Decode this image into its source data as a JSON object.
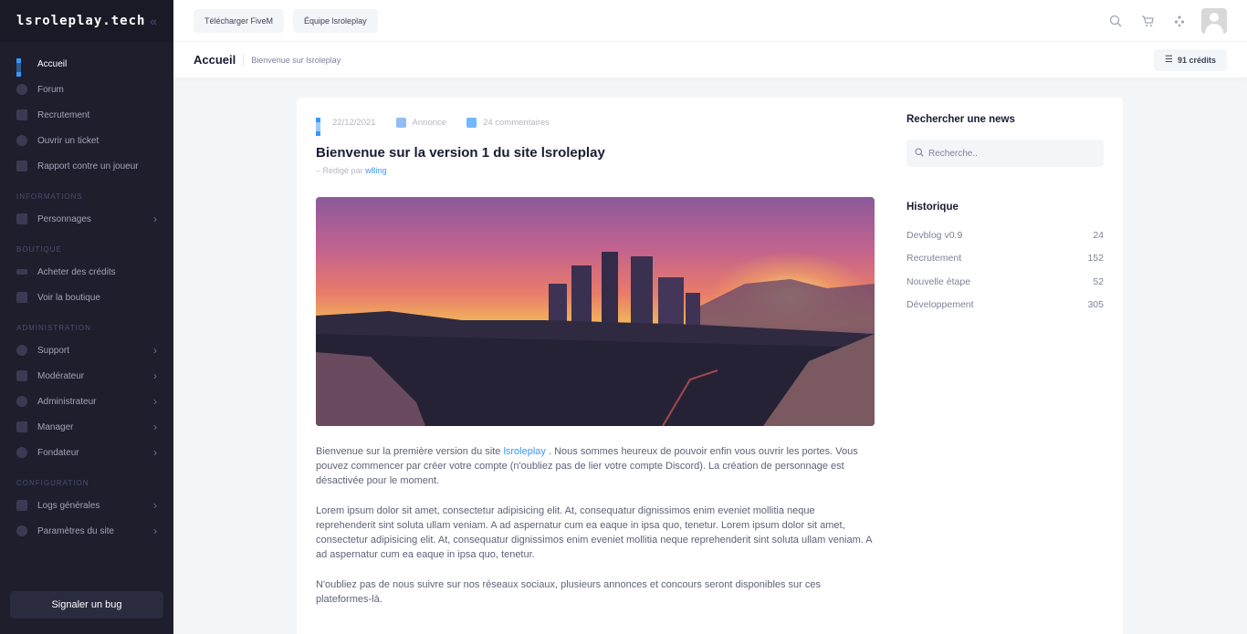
{
  "sidebar": {
    "brand": "lsroleplay.tech",
    "main_items": [
      {
        "label": "Accueil"
      },
      {
        "label": "Forum"
      },
      {
        "label": "Recrutement"
      },
      {
        "label": "Ouvrir un ticket"
      },
      {
        "label": "Rapport contre un joueur"
      }
    ],
    "sections": {
      "informations": "INFORMATIONS",
      "boutique": "BOUTIQUE",
      "administration": "ADMINISTRATION",
      "configuration": "CONFIGURATION"
    },
    "info_items": [
      {
        "label": "Personnages"
      }
    ],
    "shop_items": [
      {
        "label": "Acheter des crédits"
      },
      {
        "label": "Voir la boutique"
      }
    ],
    "admin_items": [
      {
        "label": "Support"
      },
      {
        "label": "Modérateur"
      },
      {
        "label": "Administrateur"
      },
      {
        "label": "Manager"
      },
      {
        "label": "Fondateur"
      }
    ],
    "config_items": [
      {
        "label": "Logs générales"
      },
      {
        "label": "Paramètres du site"
      }
    ],
    "bug_button": "Signaler un bug"
  },
  "topbar": {
    "buttons": [
      "Télécharger FiveM",
      "Équipe lsroleplay"
    ]
  },
  "subheader": {
    "title": "Accueil",
    "subtitle": "Bienvenue sur lsroleplay",
    "credits": "91 crédits"
  },
  "post": {
    "date": "22/12/2021",
    "category": "Annonce",
    "comments": "24 commentaires",
    "title": "Bienvenue sur la version 1 du site lsroleplay",
    "author_prefix": "–  Rédigé par",
    "author": "w8ing",
    "p1_before": "Bienvenue sur la première version du site ",
    "p1_link": "lsroleplay",
    "p1_after": " . Nous sommes heureux de pouvoir enfin vous ouvrir les portes. Vous pouvez commencer par créer votre compte (n'oubliez pas de lier votre compte Discord). La création de personnage est désactivée pour le moment.",
    "p2": "Lorem ipsum dolor sit amet, consectetur adipisicing elit. At, consequatur dignissimos enim eveniet mollitia neque reprehenderit sint soluta ullam veniam. A ad aspernatur cum ea eaque in ipsa quo, tenetur. Lorem ipsum dolor sit amet, consectetur adipisicing elit. At, consequatur dignissimos enim eveniet mollitia neque reprehenderit sint soluta ullam veniam. A ad aspernatur cum ea eaque in ipsa quo, tenetur.",
    "p3": "N'oubliez pas de nous suivre sur nos réseaux sociaux, plusieurs annonces et concours seront disponibles sur ces plateformes-là."
  },
  "aside": {
    "search_title": "Rechercher une news",
    "search_placeholder": "Recherche..",
    "history_title": "Historique",
    "history": [
      {
        "name": "Devblog v0.9",
        "count": "24"
      },
      {
        "name": "Recrutement",
        "count": "152"
      },
      {
        "name": "Nouvelle étape",
        "count": "52"
      },
      {
        "name": "Développement",
        "count": "305"
      }
    ]
  },
  "colors": {
    "sidebar_bg": "#1e1e2d",
    "accent": "#3699ff"
  }
}
